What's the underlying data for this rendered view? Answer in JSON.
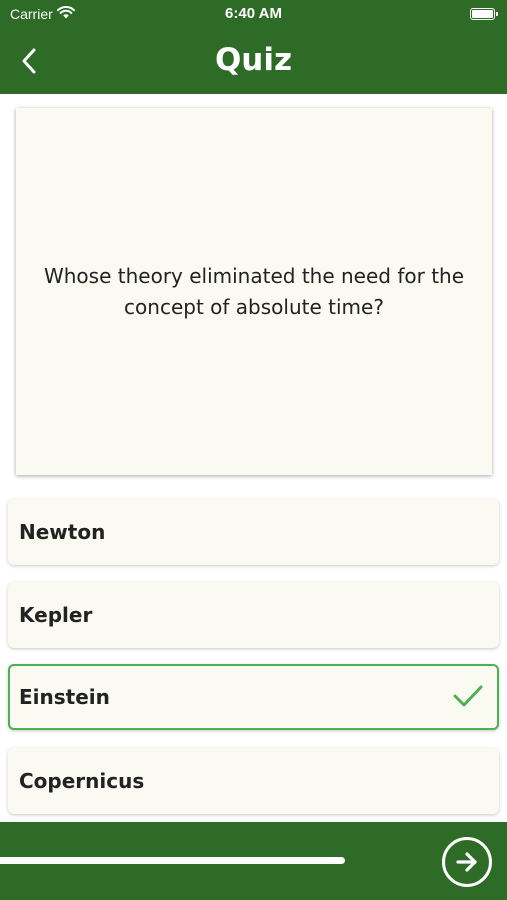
{
  "status_bar": {
    "carrier": "Carrier",
    "time": "6:40 AM",
    "battery_level": 1.0
  },
  "nav": {
    "title": "Quiz",
    "back_icon": "chevron-left-icon"
  },
  "question": {
    "text": "Whose theory eliminated the need for the concept of absolute time?"
  },
  "options": [
    {
      "label": "Newton",
      "selected": false
    },
    {
      "label": "Kepler",
      "selected": false
    },
    {
      "label": "Einstein",
      "selected": true
    },
    {
      "label": "Copernicus",
      "selected": false
    }
  ],
  "footer": {
    "progress": 0.68,
    "next_icon": "arrow-right-circle-icon"
  },
  "colors": {
    "primary": "#2e6b27",
    "card_background": "#fafaf3",
    "correct": "#4caf50",
    "text": "#222222"
  }
}
